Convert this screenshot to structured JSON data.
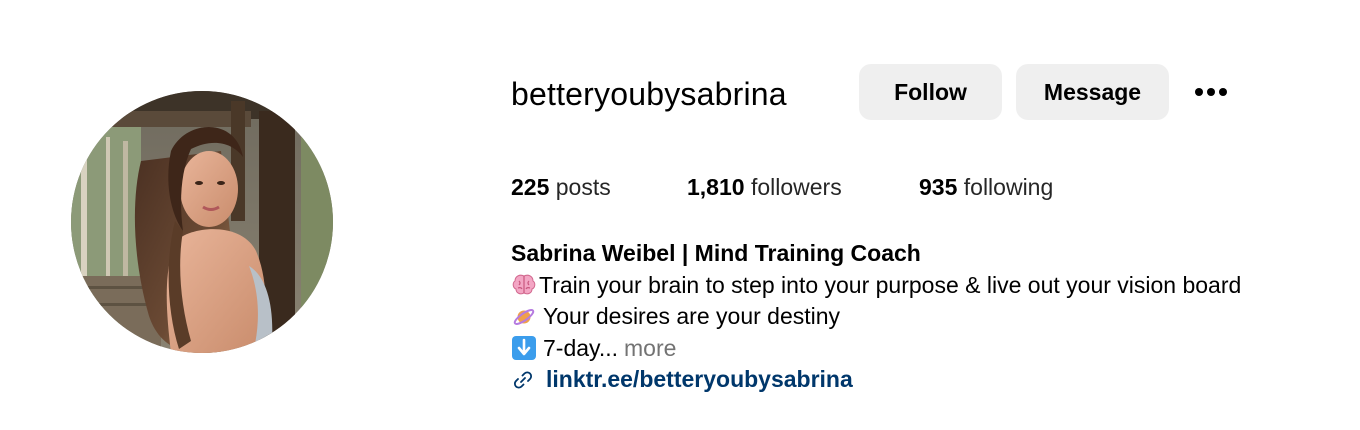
{
  "profile": {
    "username": "betteryoubysabrina",
    "follow_label": "Follow",
    "message_label": "Message",
    "more_options_icon": "ellipsis-icon",
    "avatar": "profile-photo"
  },
  "stats": {
    "posts_count": "225",
    "posts_label": "posts",
    "followers_count": "1,810",
    "followers_label": "followers",
    "following_count": "935",
    "following_label": "following"
  },
  "bio": {
    "name": "Sabrina Weibel | Mind Training Coach",
    "line1": "Train your brain to step into your purpose & live out your vision board",
    "line1_icon": "brain-icon",
    "line2": "Your desires are your destiny",
    "line2_icon": "ringed-planet-icon",
    "line3": "7-day...",
    "line3_icon": "down-arrow-icon",
    "more_label": "more",
    "link_text": "linktr.ee/betteryoubysabrina",
    "link_icon": "link-icon"
  },
  "colors": {
    "button_bg": "#efefef",
    "link": "#00376b",
    "muted": "#737373"
  }
}
